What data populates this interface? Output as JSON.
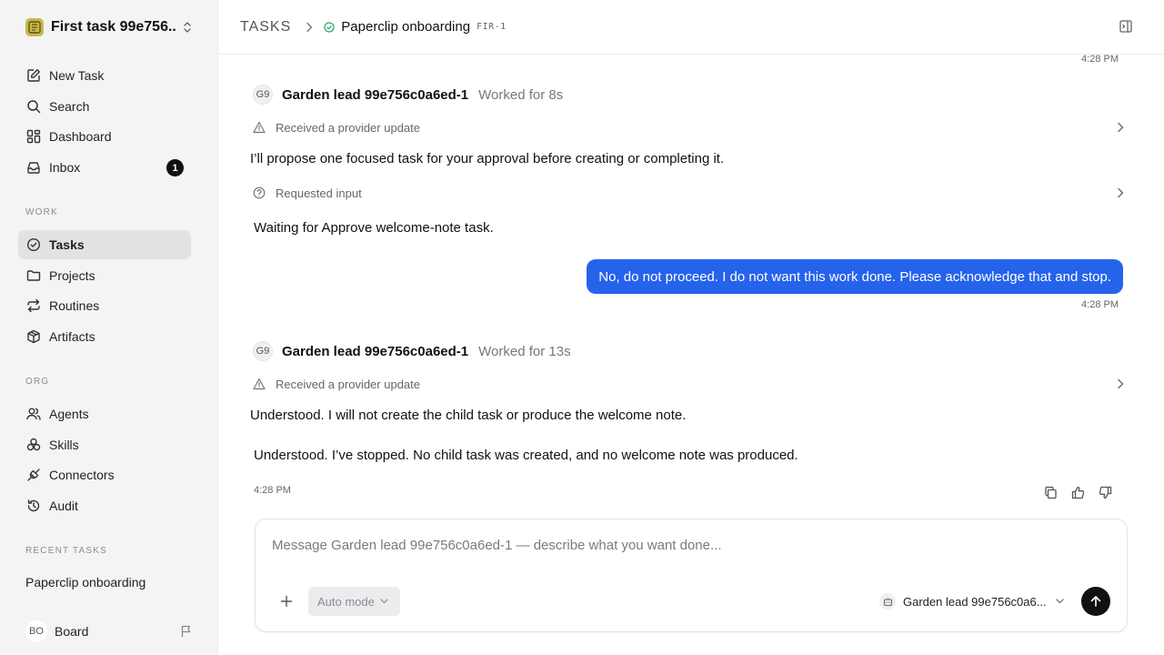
{
  "workspace": {
    "title": "First task 99e756..."
  },
  "nav": {
    "new_task": "New Task",
    "search": "Search",
    "dashboard": "Dashboard",
    "inbox": "Inbox",
    "inbox_count": "1"
  },
  "sections": {
    "work": "WORK",
    "org": "ORG",
    "recent": "RECENT TASKS"
  },
  "work_items": {
    "tasks": "Tasks",
    "projects": "Projects",
    "routines": "Routines",
    "artifacts": "Artifacts"
  },
  "org_items": {
    "agents": "Agents",
    "skills": "Skills",
    "connectors": "Connectors",
    "audit": "Audit"
  },
  "recent_tasks": [
    "Paperclip onboarding"
  ],
  "board": {
    "initials": "BO",
    "label": "Board"
  },
  "breadcrumb": {
    "root": "TASKS",
    "title": "Paperclip onboarding",
    "id": "FIR-1"
  },
  "thread": {
    "top_time": "4:28 PM",
    "blocks": [
      {
        "avatar": "G9",
        "agent": "Garden lead 99e756c0a6ed-1",
        "worked": "Worked for 8s",
        "event1": "Received a provider update",
        "message": "I’ll propose one focused task for your approval before creating or completing it.",
        "event2": "Requested input",
        "waiting": "Waiting for Approve welcome-note task."
      },
      {
        "avatar": "G9",
        "agent": "Garden lead 99e756c0a6ed-1",
        "worked": "Worked for 13s",
        "event1": "Received a provider update",
        "message": "Understood. I will not create the child task or produce the welcome note.",
        "final": "Understood. I’ve stopped. No child task was created, and no welcome note was produced.",
        "time": "4:28 PM"
      }
    ],
    "user_message": "No, do not proceed. I do not want this work done. Please acknowledge that and stop.",
    "user_time": "4:28 PM"
  },
  "composer": {
    "placeholder": "Message Garden lead 99e756c0a6ed-1 — describe what you want done...",
    "mode": "Auto mode",
    "agent": "Garden lead 99e756c0a6..."
  },
  "colors": {
    "accent": "#2563eb",
    "status_green": "#2aa66a",
    "send": "#111111"
  }
}
